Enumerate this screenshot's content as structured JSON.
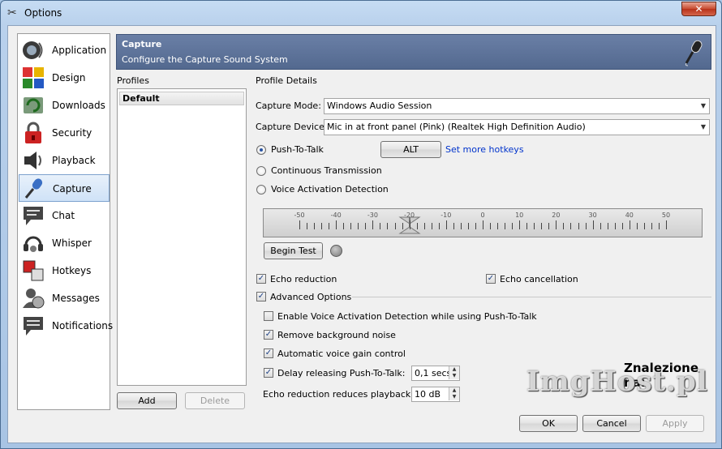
{
  "window": {
    "title": "Options",
    "close_label": "✕"
  },
  "sidebar": {
    "items": [
      {
        "label": "Application",
        "icon": "speaker-app-icon"
      },
      {
        "label": "Design",
        "icon": "design-tiles-icon"
      },
      {
        "label": "Downloads",
        "icon": "downloads-icon"
      },
      {
        "label": "Security",
        "icon": "lock-icon"
      },
      {
        "label": "Playback",
        "icon": "speaker-playback-icon"
      },
      {
        "label": "Capture",
        "icon": "microphone-icon",
        "active": true
      },
      {
        "label": "Chat",
        "icon": "chat-bubble-icon"
      },
      {
        "label": "Whisper",
        "icon": "headset-icon"
      },
      {
        "label": "Hotkeys",
        "icon": "hotkeys-icon"
      },
      {
        "label": "Messages",
        "icon": "messages-icon"
      },
      {
        "label": "Notifications",
        "icon": "notifications-icon"
      }
    ]
  },
  "header": {
    "title": "Capture",
    "subtitle": "Configure the Capture Sound System"
  },
  "profiles": {
    "heading": "Profiles",
    "items": [
      "Default"
    ],
    "add_label": "Add",
    "delete_label": "Delete"
  },
  "details": {
    "heading": "Profile Details",
    "capture_mode_label": "Capture Mode:",
    "capture_mode_value": "Windows Audio Session",
    "capture_device_label": "Capture Device:",
    "capture_device_value": "Mic in at front panel (Pink) (Realtek High Definition Audio)",
    "push_to_talk": "Push-To-Talk",
    "hotkey_label": "ALT",
    "more_hotkeys": "Set more hotkeys",
    "continuous": "Continuous Transmission",
    "vad": "Voice Activation Detection",
    "meter_ticks": [
      "-50",
      "-40",
      "-30",
      "-20",
      "-10",
      "0",
      "10",
      "20",
      "30",
      "40",
      "50"
    ],
    "begin_test": "Begin Test",
    "echo_reduction": "Echo reduction",
    "echo_cancellation": "Echo cancellation",
    "advanced_options": "Advanced Options",
    "enable_vad_ptt": "Enable Voice Activation Detection while using Push-To-Talk",
    "remove_noise": "Remove background noise",
    "auto_gain": "Automatic voice gain control",
    "delay_label": "Delay releasing Push-To-Talk:",
    "delay_value": "0,1 secs",
    "echo_playback_label": "Echo reduction reduces playback by:",
    "echo_playback_value": "10 dB"
  },
  "footer": {
    "ok": "OK",
    "cancel": "Cancel",
    "apply": "Apply"
  },
  "watermark": {
    "top": "Znalezione na:",
    "brand": "ImgHost.pl"
  }
}
